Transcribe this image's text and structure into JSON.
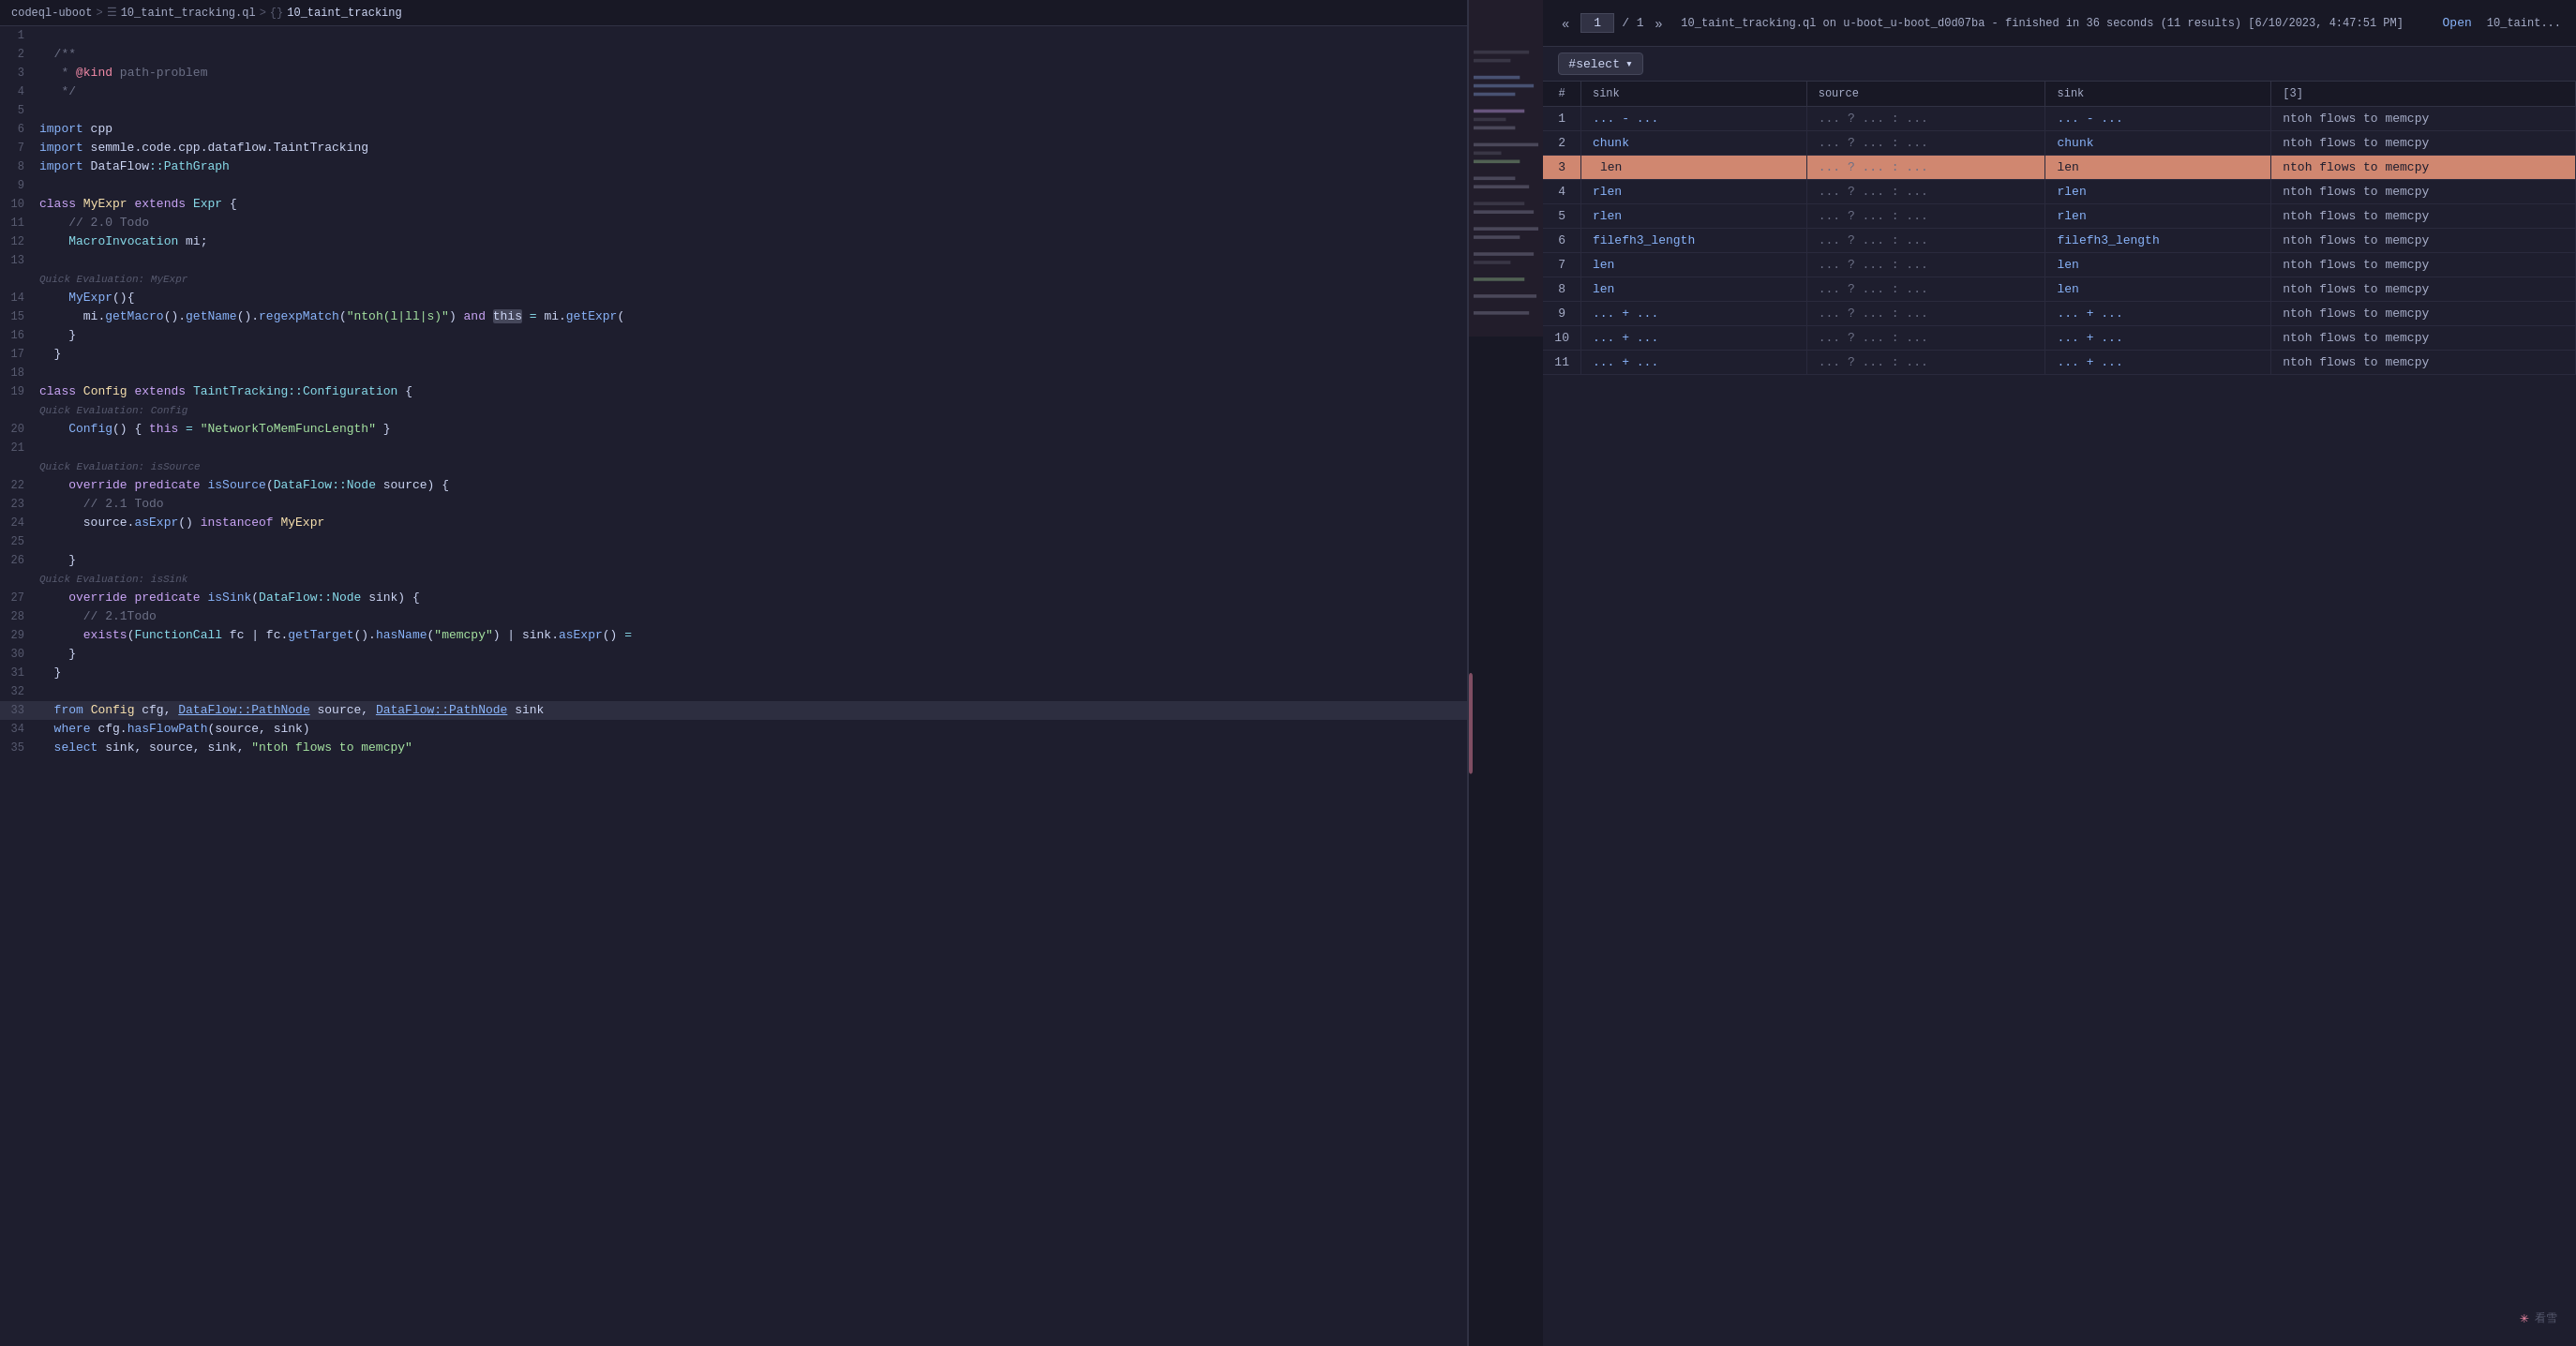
{
  "breadcrumb": {
    "items": [
      {
        "label": "codeql-uboot",
        "active": false
      },
      {
        "label": "10_taint_tracking.ql",
        "active": false
      },
      {
        "label": "10_taint_tracking",
        "active": true
      }
    ],
    "separators": [
      ">",
      ">",
      "{}"
    ]
  },
  "editor": {
    "lines": [
      {
        "num": 1,
        "content": "",
        "tokens": []
      },
      {
        "num": 2,
        "content": "  /**",
        "type": "comment"
      },
      {
        "num": 3,
        "content": "   * @kind path-problem",
        "type": "comment"
      },
      {
        "num": 4,
        "content": "   */",
        "type": "comment"
      },
      {
        "num": 5,
        "content": "",
        "tokens": []
      },
      {
        "num": 6,
        "content": "  import cpp",
        "type": "import"
      },
      {
        "num": 7,
        "content": "  import semmle.code.cpp.dataflow.TaintTracking",
        "type": "import"
      },
      {
        "num": 8,
        "content": "  import DataFlow::PathGraph",
        "type": "import"
      },
      {
        "num": 9,
        "content": "",
        "tokens": []
      },
      {
        "num": 10,
        "content": "  class MyExpr extends Expr {",
        "type": "class"
      },
      {
        "num": 11,
        "content": "    // 2.0 Todo",
        "type": "comment-inline"
      },
      {
        "num": 12,
        "content": "    MacroInvocation mi;",
        "type": "code"
      },
      {
        "num": 13,
        "content": "",
        "tokens": []
      },
      {
        "num": 13,
        "quick_eval": "Quick Evaluation: MyExpr"
      },
      {
        "num": 14,
        "content": "    MyExpr(){",
        "type": "code"
      },
      {
        "num": 15,
        "content": "      mi.getMacro().getName().regexpMatch(\"ntoh(l|ll|s)\") and this = mi.getExpr(",
        "type": "code",
        "has_this": true
      },
      {
        "num": 16,
        "content": "    }",
        "type": "code"
      },
      {
        "num": 17,
        "content": "  }",
        "type": "code"
      },
      {
        "num": 18,
        "content": "",
        "tokens": []
      },
      {
        "num": 19,
        "content": "  class Config extends TaintTracking::Configuration {",
        "type": "class"
      },
      {
        "num": 20,
        "quick_eval": "Quick Evaluation: Config"
      },
      {
        "num": 20,
        "content": "    Config() { this = \"NetworkToMemFuncLength\" }",
        "type": "code"
      },
      {
        "num": 21,
        "content": "",
        "tokens": []
      },
      {
        "num": 22,
        "quick_eval": "Quick Evaluation: isSource"
      },
      {
        "num": 22,
        "content": "    override predicate isSource(DataFlow::Node source) {",
        "type": "code"
      },
      {
        "num": 23,
        "content": "      // 2.1 Todo",
        "type": "comment-inline"
      },
      {
        "num": 24,
        "content": "      source.asExpr() instanceof MyExpr",
        "type": "code"
      },
      {
        "num": 25,
        "content": "",
        "tokens": []
      },
      {
        "num": 26,
        "content": "    }",
        "type": "code"
      },
      {
        "num": 27,
        "quick_eval": "Quick Evaluation: isSink"
      },
      {
        "num": 27,
        "content": "    override predicate isSink(DataFlow::Node sink) {",
        "type": "code"
      },
      {
        "num": 28,
        "content": "      // 2.1Todo",
        "type": "comment-inline"
      },
      {
        "num": 29,
        "content": "      exists(FunctionCall fc | fc.getTarget().hasName(\"memcpy\") | sink.asExpr() =",
        "type": "code"
      },
      {
        "num": 30,
        "content": "    }",
        "type": "code"
      },
      {
        "num": 31,
        "content": "  }",
        "type": "code"
      },
      {
        "num": 32,
        "content": "",
        "tokens": []
      },
      {
        "num": 33,
        "content": "  from Config cfg, DataFlow::PathNode source, DataFlow::PathNode sink",
        "type": "code",
        "highlighted": true
      },
      {
        "num": 34,
        "content": "  where cfg.hasFlowPath(source, sink)",
        "type": "code"
      },
      {
        "num": 35,
        "content": "  select sink, source, sink, \"ntoh flows to memcpy\"",
        "type": "code"
      }
    ]
  },
  "results": {
    "header": {
      "prev_label": "«",
      "page_value": "1",
      "page_total": "/ 1",
      "next_label": "»",
      "info": "10_taint_tracking.ql on u-boot_u-boot_d0d07ba - finished in 36 seconds (11 results) [6/10/2023, 4:47:51 PM]",
      "open_label": "Open",
      "tab_label": "10_taint..."
    },
    "select_label": "#select",
    "columns": [
      "#",
      "sink",
      "source",
      "sink",
      "[3]"
    ],
    "rows": [
      {
        "num": 1,
        "sink1": "... - ...",
        "source": "... ? ... : ...",
        "sink2": "... - ...",
        "desc": "ntoh flows to memcpy",
        "selected": false
      },
      {
        "num": 2,
        "sink1": "chunk",
        "source": "... ? ... : ...",
        "sink2": "chunk",
        "desc": "ntoh flows to memcpy",
        "selected": false
      },
      {
        "num": 3,
        "sink1": "len",
        "source": "... ? ... : ...",
        "sink2": "len",
        "desc": "ntoh flows to memcpy",
        "selected": true
      },
      {
        "num": 4,
        "sink1": "rlen",
        "source": "... ? ... : ...",
        "sink2": "rlen",
        "desc": "ntoh flows to memcpy",
        "selected": false
      },
      {
        "num": 5,
        "sink1": "rlen",
        "source": "... ? ... : ...",
        "sink2": "rlen",
        "desc": "ntoh flows to memcpy",
        "selected": false
      },
      {
        "num": 6,
        "sink1": "filefh3_length",
        "source": "... ? ... : ...",
        "sink2": "filefh3_length",
        "desc": "ntoh flows to memcpy",
        "selected": false
      },
      {
        "num": 7,
        "sink1": "len",
        "source": "... ? ... : ...",
        "sink2": "len",
        "desc": "ntoh flows to memcpy",
        "selected": false
      },
      {
        "num": 8,
        "sink1": "len",
        "source": "... ? ... : ...",
        "sink2": "len",
        "desc": "ntoh flows to memcpy",
        "selected": false
      },
      {
        "num": 9,
        "sink1": "... + ...",
        "source": "... ? ... : ...",
        "sink2": "... + ...",
        "desc": "ntoh flows to memcpy",
        "selected": false
      },
      {
        "num": 10,
        "sink1": "... + ...",
        "source": "... ? ... : ...",
        "sink2": "... + ...",
        "desc": "ntoh flows to memcpy",
        "selected": false
      },
      {
        "num": 11,
        "sink1": "... + ...",
        "source": "... ? ... : ...",
        "sink2": "... + ...",
        "desc": "ntoh flows to memcpy",
        "selected": false
      }
    ]
  },
  "watermark": {
    "icon": "✳",
    "text": "看雪"
  },
  "colors": {
    "selected_row_bg": "#d08770",
    "link_color": "#89b4fa",
    "keyword_color": "#cba6f7",
    "comment_color": "#6c7086",
    "string_color": "#a6e3a1",
    "type_color": "#89dceb"
  }
}
